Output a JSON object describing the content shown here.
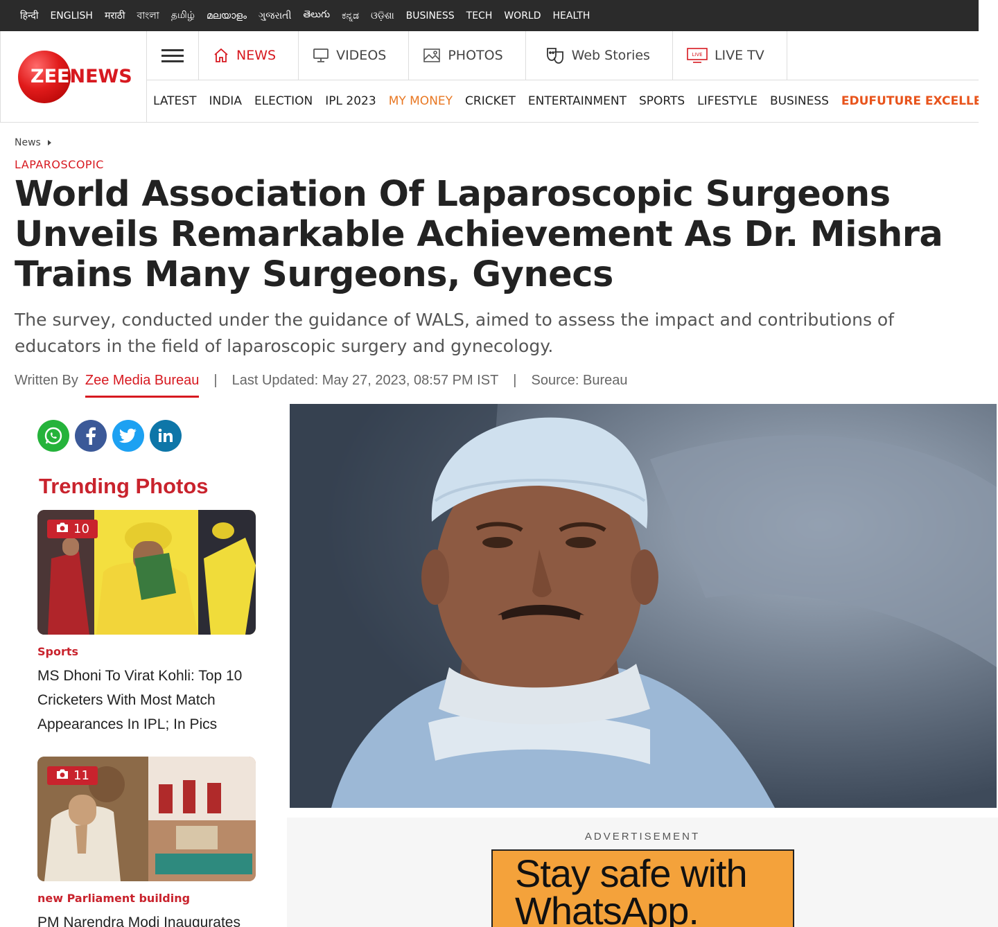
{
  "languages": [
    "हिन्दी",
    "ENGLISH",
    "मराठी",
    "বাংলা",
    "தமிழ்",
    "മലയാളം",
    "ગુજરાતી",
    "తెలుగు",
    "ಕನ್ನಡ",
    "ଓଡ଼ିଶା",
    "BUSINESS",
    "TECH",
    "WORLD",
    "HEALTH"
  ],
  "logo": {
    "zee": "ZEE",
    "news": "NEWS"
  },
  "primary_nav": [
    {
      "label": "NEWS",
      "icon": "home-icon",
      "active": true
    },
    {
      "label": "VIDEOS",
      "icon": "monitor-icon"
    },
    {
      "label": "PHOTOS",
      "icon": "photo-icon"
    },
    {
      "label": "Web Stories",
      "icon": "masks-icon"
    },
    {
      "label": "LIVE TV",
      "icon": "live-tv-icon",
      "icon_text": "LIVE"
    }
  ],
  "secondary_nav": [
    "LATEST",
    "INDIA",
    "ELECTION",
    "IPL 2023",
    "MY MONEY",
    "CRICKET",
    "ENTERTAINMENT",
    "SPORTS",
    "LIFESTYLE",
    "BUSINESS",
    "EDUFUTURE EXCELLENCE AW"
  ],
  "breadcrumb": "News",
  "category": "LAPAROSCOPIC",
  "headline": "World Association Of Laparoscopic Surgeons Unveils Remarkable Achievement As Dr. Mishra Trains Many Surgeons, Gynecs",
  "subhead": "The survey, conducted under the guidance of WALS, aimed to assess the impact and contributions of educators in the field of laparoscopic surgery and gynecology.",
  "meta": {
    "written_by": "Written By",
    "author": "Zee Media Bureau",
    "separator": "|",
    "updated": "Last Updated: May 27, 2023, 08:57 PM IST",
    "source": "Source: Bureau"
  },
  "social": [
    "whatsapp-icon",
    "facebook-icon",
    "twitter-icon",
    "linkedin-icon"
  ],
  "trending": {
    "title": "Trending Photos",
    "items": [
      {
        "count": "10",
        "category": "Sports",
        "title": "MS Dhoni To Virat Kohli: Top 10 Cricketers With Most Match Appearances In IPL; In Pics"
      },
      {
        "count": "11",
        "category": "new Parliament building",
        "title": "PM Narendra Modi Inaugurates"
      }
    ]
  },
  "advertisement": {
    "label": "ADVERTISEMENT",
    "creative_text": "Stay safe with WhatsApp."
  },
  "colors": {
    "brand_red": "#d71920",
    "money_orange": "#e87722",
    "topbar": "#2b2b2b"
  }
}
